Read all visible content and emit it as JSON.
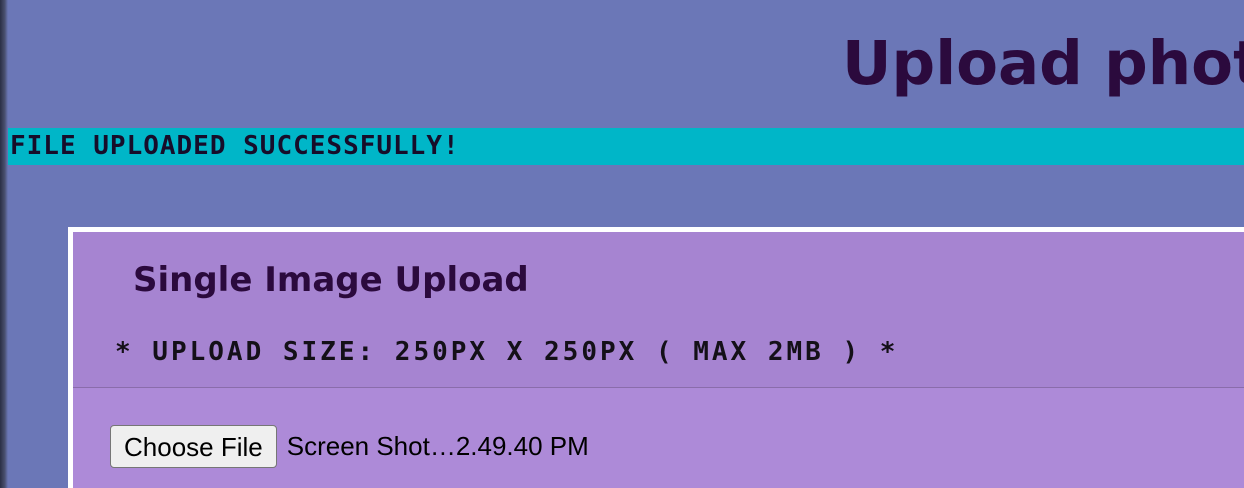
{
  "page": {
    "title": "Upload phot"
  },
  "banner": {
    "message": "FILE UPLOADED SUCCESSFULLY!"
  },
  "upload_card": {
    "heading": "Single Image Upload",
    "size_note": "* UPLOAD SIZE: 250PX X 250PX ( MAX 2MB ) *",
    "file_input": {
      "button_label": "Choose File",
      "selected_file": "Screen Shot…2.49.40 PM"
    }
  },
  "colors": {
    "page_background": "#6b77b7",
    "banner_background": "#00b6c8",
    "card_background": "#a684d1",
    "heading_text": "#2b0a3d"
  }
}
